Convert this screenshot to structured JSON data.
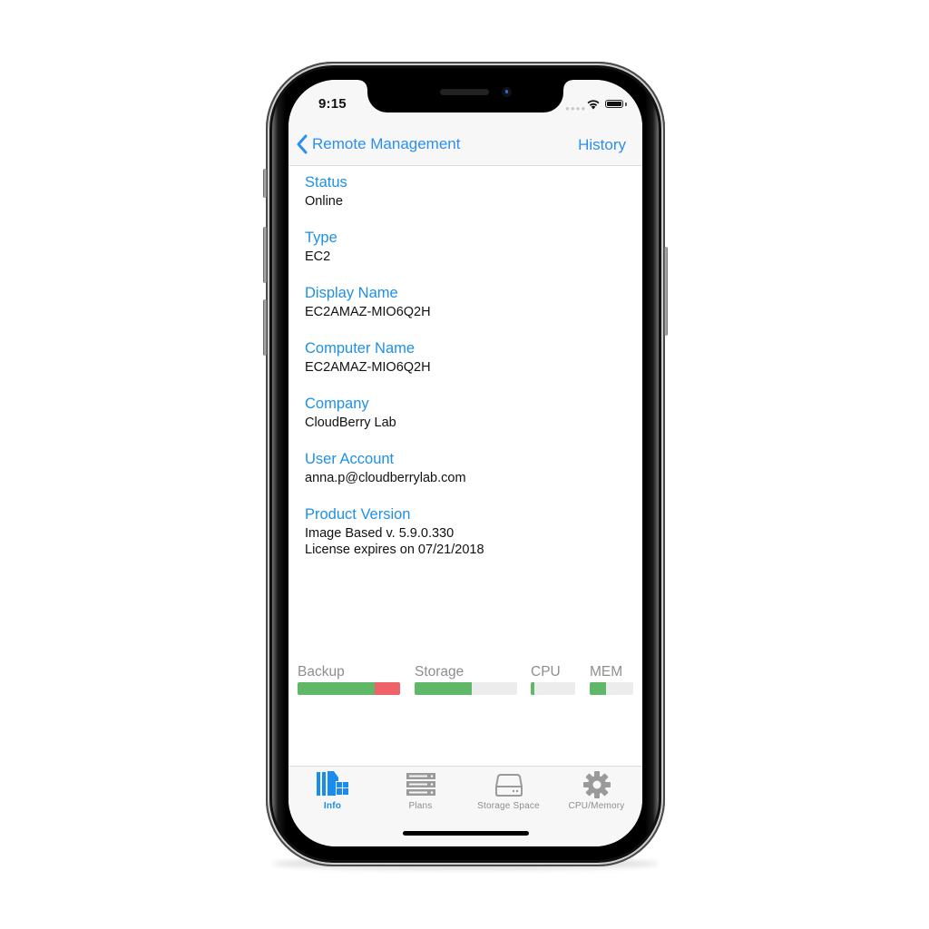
{
  "status_bar": {
    "time": "9:15",
    "signal_icon": "cellular-signal-icon",
    "wifi_icon": "wifi-icon",
    "battery_icon": "battery-icon"
  },
  "nav": {
    "back_label": "Remote Management",
    "back_icon": "chevron-left-icon",
    "right_action": "History"
  },
  "fields": [
    {
      "label": "Status",
      "value": "Online"
    },
    {
      "label": "Type",
      "value": "EC2"
    },
    {
      "label": "Display Name",
      "value": "EC2AMAZ-MIO6Q2H"
    },
    {
      "label": "Computer Name",
      "value": "EC2AMAZ-MIO6Q2H"
    },
    {
      "label": "Company",
      "value": "CloudBerry Lab"
    },
    {
      "label": "User Account",
      "value": "anna.p@cloudberrylab.com"
    },
    {
      "label": "Product Version",
      "value": "Image Based v. 5.9.0.330",
      "value2": "License expires on 07/21/2018"
    }
  ],
  "usage_bars": [
    {
      "label": "Backup",
      "green_fraction": 0.75,
      "red_fraction": 0.25
    },
    {
      "label": "Storage",
      "green_fraction": 0.56,
      "red_fraction": 0
    },
    {
      "label": "CPU",
      "green_fraction": 0.08,
      "red_fraction": 0
    },
    {
      "label": "MEM",
      "green_fraction": 0.38,
      "red_fraction": 0
    }
  ],
  "colors": {
    "accent": "#1e90e6",
    "bar_green": "#5fb867",
    "bar_red": "#f0626a",
    "bar_track": "#ececec",
    "tab_inactive": "#8e8e8e"
  },
  "tabs": [
    {
      "label": "Info",
      "icon": "info-server-windows-icon",
      "active": true
    },
    {
      "label": "Plans",
      "icon": "server-stack-icon",
      "active": false
    },
    {
      "label": "Storage Space",
      "icon": "hard-drive-icon",
      "active": false
    },
    {
      "label": "CPU/Memory",
      "icon": "gear-icon",
      "active": false
    }
  ]
}
